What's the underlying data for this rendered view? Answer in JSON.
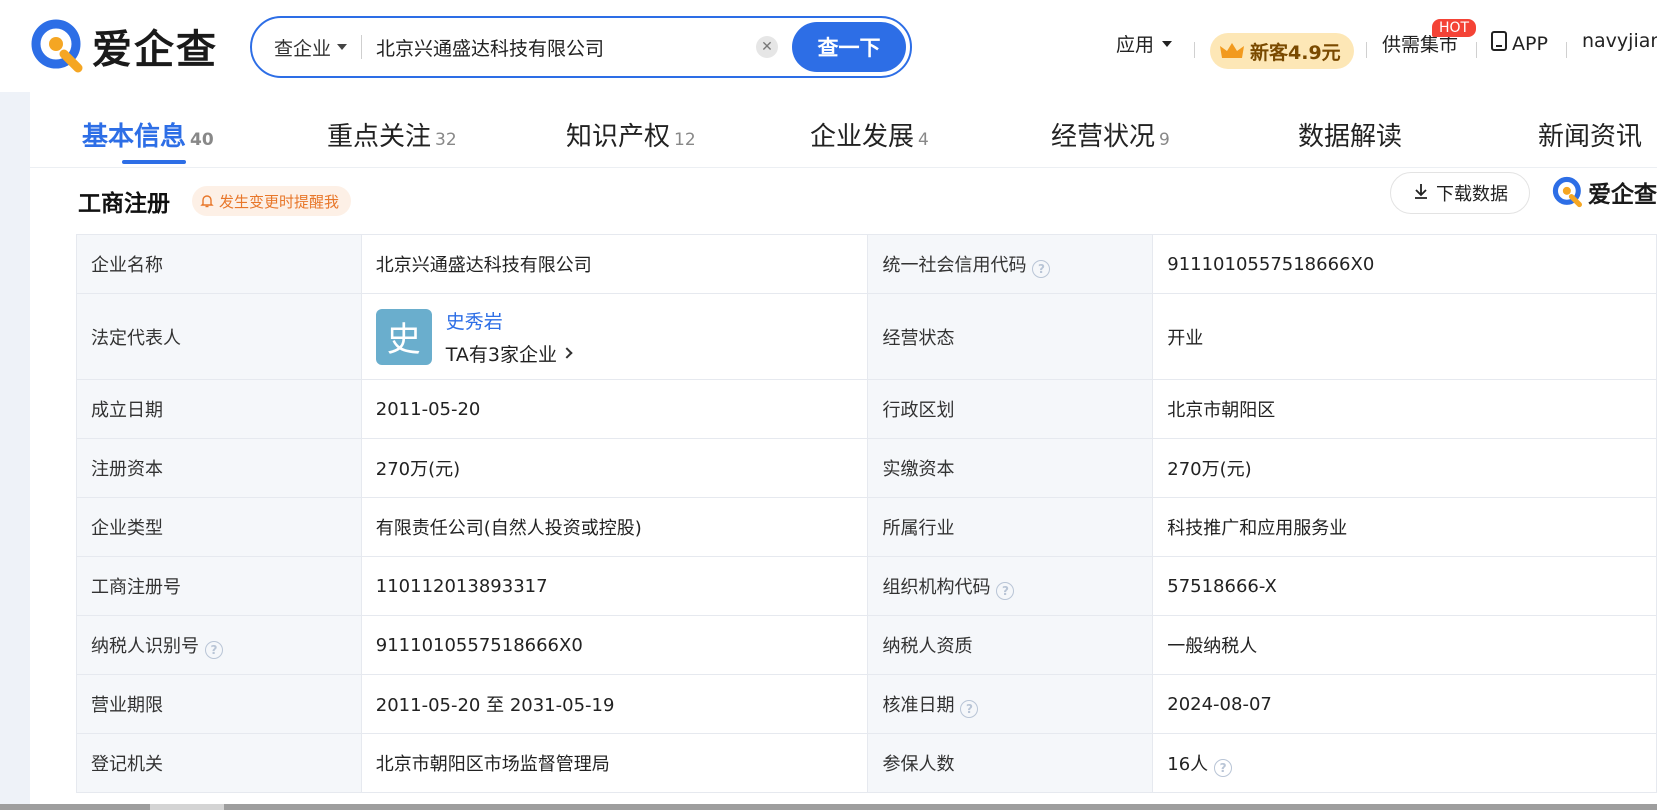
{
  "brand": {
    "logo_text": "爱企查",
    "colors": {
      "primary": "#2d6ee6",
      "logo_orange": "#f5a623"
    }
  },
  "search": {
    "type_label": "查企业",
    "value": "北京兴通盛达科技有限公司",
    "clear_icon": "close-icon",
    "button_label": "查一下"
  },
  "header_nav": {
    "apps_label": "应用",
    "vip_label": "新客4.9元",
    "market_label": "供需集市",
    "hot_badge": "HOT",
    "app_label": "APP",
    "user_label": "navyjiang"
  },
  "tabs": [
    {
      "label": "基本信息",
      "count": "40",
      "active": true
    },
    {
      "label": "重点关注",
      "count": "32"
    },
    {
      "label": "知识产权",
      "count": "12"
    },
    {
      "label": "企业发展",
      "count": "4"
    },
    {
      "label": "经营状况",
      "count": "9"
    },
    {
      "label": "数据解读",
      "count": ""
    },
    {
      "label": "新闻资讯",
      "count": ""
    }
  ],
  "section": {
    "title": "工商注册",
    "remind_label": "发生变更时提醒我",
    "download_label": "下载数据",
    "mini_logo_text": "爱企查"
  },
  "info": {
    "company_name_label": "企业名称",
    "company_name": "北京兴通盛达科技有限公司",
    "credit_code_label": "统一社会信用代码",
    "credit_code": "9111010557518666X0",
    "legal_rep_label": "法定代表人",
    "legal_rep_avatar": "史",
    "legal_rep_name": "史秀岩",
    "legal_rep_companies": "TA有3家企业",
    "status_label": "经营状态",
    "status": "开业",
    "founded_label": "成立日期",
    "founded": "2011-05-20",
    "district_label": "行政区划",
    "district": "北京市朝阳区",
    "reg_capital_label": "注册资本",
    "reg_capital": "270万(元)",
    "paid_capital_label": "实缴资本",
    "paid_capital": "270万(元)",
    "type_label": "企业类型",
    "type": "有限责任公司(自然人投资或控股)",
    "industry_label": "所属行业",
    "industry": "科技推广和应用服务业",
    "reg_no_label": "工商注册号",
    "reg_no": "110112013893317",
    "org_code_label": "组织机构代码",
    "org_code": "57518666-X",
    "taxpayer_id_label": "纳税人识别号",
    "taxpayer_id": "9111010557518666X0",
    "taxpayer_qual_label": "纳税人资质",
    "taxpayer_qual": "一般纳税人",
    "term_label": "营业期限",
    "term": "2011-05-20 至 2031-05-19",
    "approval_date_label": "核准日期",
    "approval_date": "2024-08-07",
    "authority_label": "登记机关",
    "authority": "北京市朝阳区市场监督管理局",
    "insured_label": "参保人数",
    "insured": "16人",
    "help_icon": "question-icon"
  }
}
